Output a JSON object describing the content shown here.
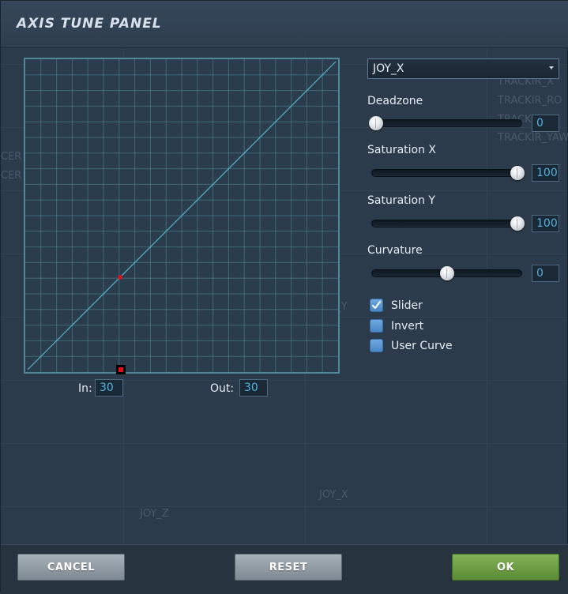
{
  "panel": {
    "title": "AXIS TUNE PANEL"
  },
  "graph": {
    "in_label": "In:",
    "in_value": "30",
    "out_label": "Out:",
    "out_value": "30",
    "point_in_percent": 30,
    "line_color": "#5ab4cc",
    "grid_color": "#4f8a99",
    "marker_color": "#e0101a"
  },
  "axis_select": {
    "selected": "JOY_X"
  },
  "controls": {
    "deadzone": {
      "label": "Deadzone",
      "value": "0",
      "fraction": 0.0
    },
    "saturation_x": {
      "label": "Saturation X",
      "value": "100",
      "fraction": 1.0
    },
    "saturation_y": {
      "label": "Saturation Y",
      "value": "100",
      "fraction": 1.0
    },
    "curvature": {
      "label": "Curvature",
      "value": "0",
      "fraction": 0.5
    }
  },
  "options": {
    "slider": {
      "label": "Slider",
      "checked": true
    },
    "invert": {
      "label": "Invert",
      "checked": false
    },
    "user_curve": {
      "label": "User Curve",
      "checked": false
    }
  },
  "background_labels": {
    "a": "TRACKIR_X",
    "b": "TRACKIR_RO",
    "c": "TRACK",
    "d": "TRACKIR_YAW",
    "e": "JOY_Y",
    "f": "JOY_X",
    "g": "JOY_Z",
    "h": "CER",
    "i": "CER"
  },
  "buttons": {
    "cancel": "CANCEL",
    "reset": "RESET",
    "ok": "OK"
  },
  "colors": {
    "accent_blue": "#4fb3e0",
    "ok_green": "#6a9c42",
    "panel_bg": "#2c3b4b"
  }
}
